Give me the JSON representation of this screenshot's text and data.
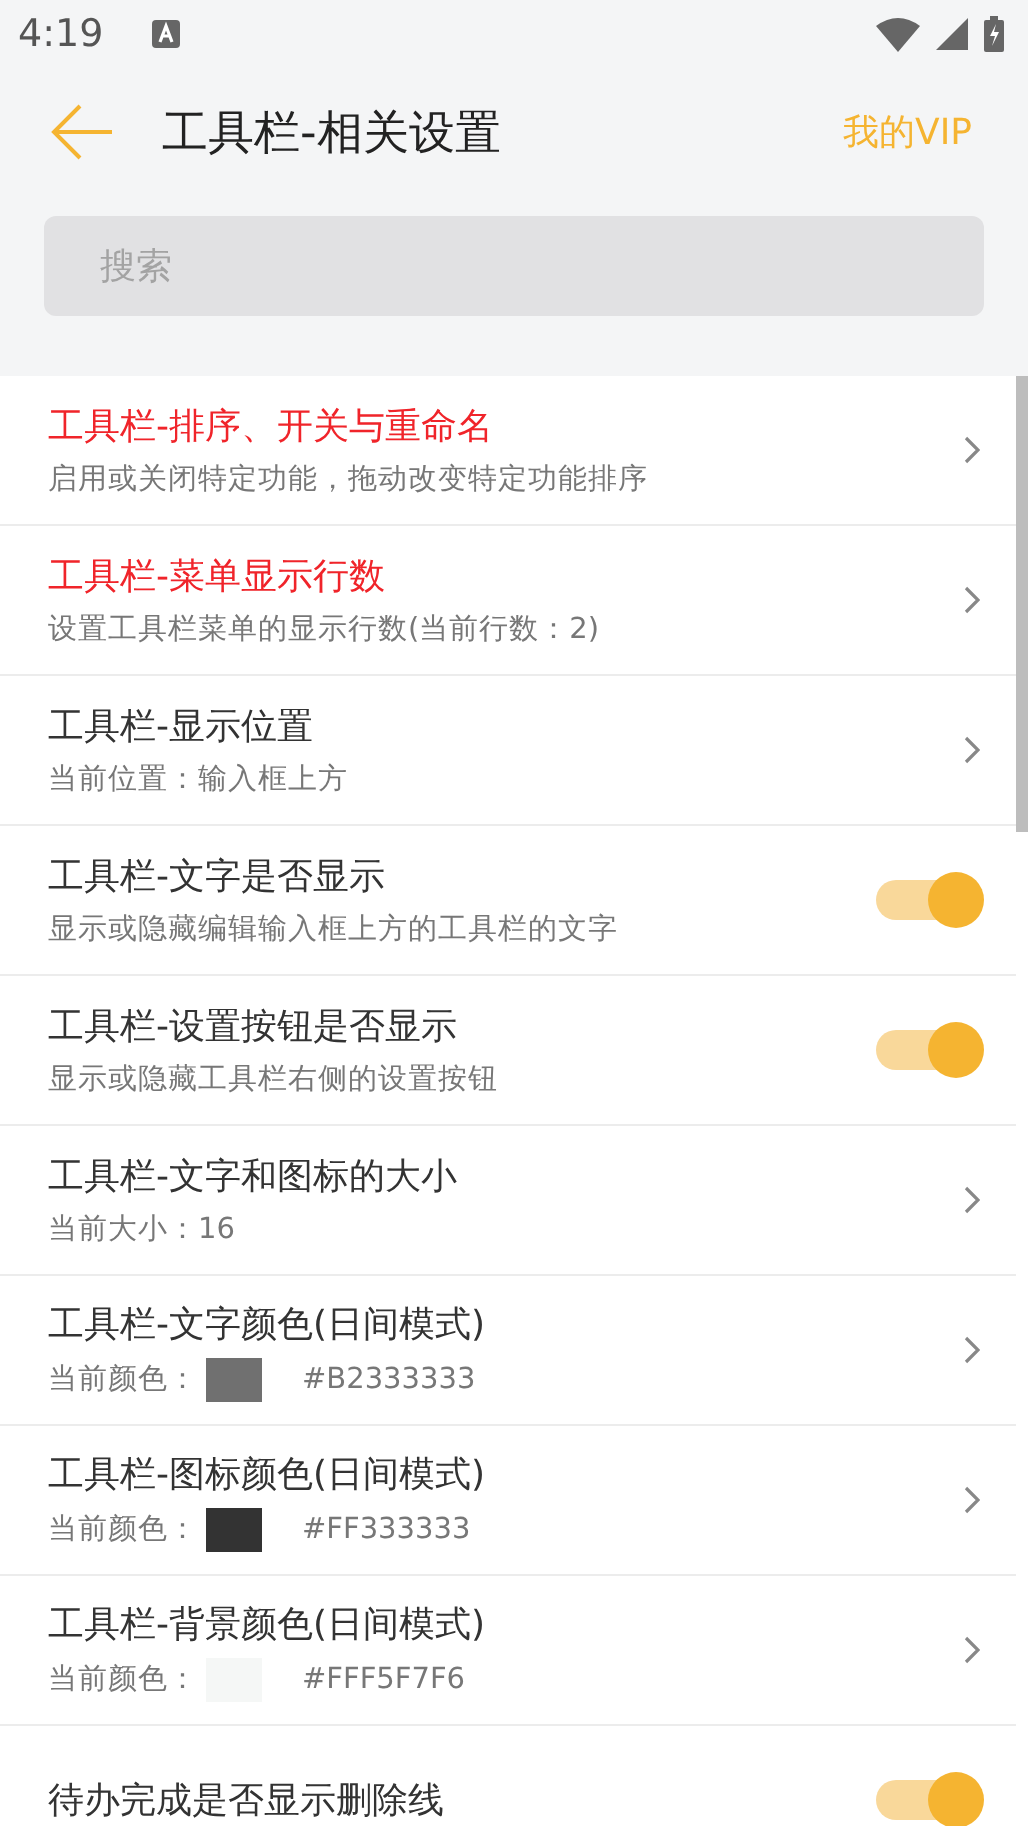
{
  "status_bar": {
    "time": "4:19"
  },
  "header": {
    "title": "工具栏-相关设置",
    "action": "我的VIP"
  },
  "search": {
    "placeholder": "搜索"
  },
  "rows": [
    {
      "kind": "link",
      "title": "工具栏-排序、开关与重命名",
      "subtitle": "启用或关闭特定功能，拖动改变特定功能排序",
      "highlight": true
    },
    {
      "kind": "link",
      "title": "工具栏-菜单显示行数",
      "subtitle": "设置工具栏菜单的显示行数(当前行数：2)",
      "highlight": true
    },
    {
      "kind": "link",
      "title": "工具栏-显示位置",
      "subtitle": "当前位置：输入框上方",
      "highlight": false
    },
    {
      "kind": "toggle",
      "title": "工具栏-文字是否显示",
      "subtitle": "显示或隐藏编辑输入框上方的工具栏的文字",
      "highlight": false,
      "on": true
    },
    {
      "kind": "toggle",
      "title": "工具栏-设置按钮是否显示",
      "subtitle": "显示或隐藏工具栏右侧的设置按钮",
      "highlight": false,
      "on": true
    },
    {
      "kind": "link",
      "title": "工具栏-文字和图标的大小",
      "subtitle": "当前大小：16",
      "highlight": false
    },
    {
      "kind": "color",
      "title": "工具栏-文字颜色(日间模式)",
      "subtitle": "当前颜色：",
      "value": "#B2333333",
      "color": "#707070",
      "highlight": false
    },
    {
      "kind": "color",
      "title": "工具栏-图标颜色(日间模式)",
      "subtitle": "当前颜色：",
      "value": "#FF333333",
      "color": "#333333",
      "highlight": false
    },
    {
      "kind": "color",
      "title": "工具栏-背景颜色(日间模式)",
      "subtitle": "当前颜色：",
      "value": "#FFF5F7F6",
      "color": "#f5f7f6",
      "highlight": false
    },
    {
      "kind": "toggle",
      "title": "待办完成是否显示删除线",
      "highlight": false,
      "on": true
    }
  ]
}
